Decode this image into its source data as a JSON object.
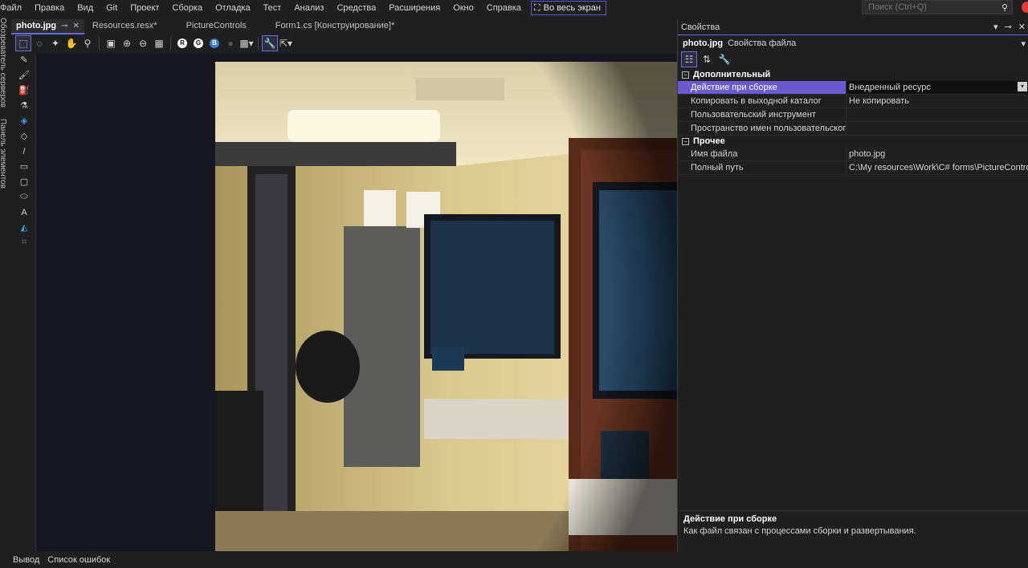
{
  "menu": {
    "items": [
      "Файл",
      "Правка",
      "Вид",
      "Git",
      "Проект",
      "Сборка",
      "Отладка",
      "Тест",
      "Анализ",
      "Средства",
      "Расширения",
      "Окно",
      "Справка"
    ],
    "fullscreen_label": "Во весь экран"
  },
  "search": {
    "placeholder": "Поиск (Ctrl+Q)"
  },
  "left_rail": {
    "server_explorer": "Обозреватель серверов",
    "toolbox": "Панель элементов"
  },
  "tabs": [
    {
      "label": "photo.jpg",
      "active": true
    },
    {
      "label": "Resources.resx*",
      "active": false
    },
    {
      "label": "PictureControls",
      "active": false
    },
    {
      "label": "Form1.cs [Конструирование]*",
      "active": false
    }
  ],
  "toolbar_icons": [
    "select-rect-icon",
    "lasso-icon",
    "magic-wand-icon",
    "hand-pan-icon",
    "zoom-icon",
    "fit-icon",
    "zoom-in-icon",
    "zoom-out-icon",
    "grid-icon",
    "red-channel-icon",
    "green-channel-icon",
    "blue-channel-icon",
    "alpha-channel-icon",
    "transparency-icon",
    "properties-icon",
    "export-icon"
  ],
  "channel_labels": {
    "r": "R",
    "g": "G",
    "b": "B"
  },
  "tools": [
    "pencil-icon",
    "brush-icon",
    "airbrush-icon",
    "eyedropper-icon",
    "fill-icon",
    "eraser-icon",
    "line-icon",
    "rectangle-icon",
    "rounded-rect-icon",
    "ellipse-icon",
    "text-icon",
    "crop-icon",
    "select-icon"
  ],
  "text_tool_label": "A",
  "properties": {
    "title": "Свойства",
    "file_name": "photo.jpg",
    "file_kind": "Свойства файла",
    "categories": [
      {
        "name": "Дополнительный",
        "rows": [
          {
            "name": "Действие при сборке",
            "value": "Внедренный ресурс",
            "selected": true
          },
          {
            "name": "Копировать в выходной каталог",
            "value": "Не копировать"
          },
          {
            "name": "Пользовательский инструмент",
            "value": ""
          },
          {
            "name": "Пространство имен пользовательского",
            "value": ""
          }
        ]
      },
      {
        "name": "Прочее",
        "rows": [
          {
            "name": "Имя файла",
            "value": "photo.jpg"
          },
          {
            "name": "Полный путь",
            "value": "C:\\My resources\\Work\\C# forms\\PictureControls\\F"
          }
        ]
      }
    ],
    "description_title": "Действие при сборке",
    "description_text": "Как файл связан с процессами сборки и развертывания."
  },
  "bottom_tabs": [
    "Вывод",
    "Список ошибок"
  ]
}
